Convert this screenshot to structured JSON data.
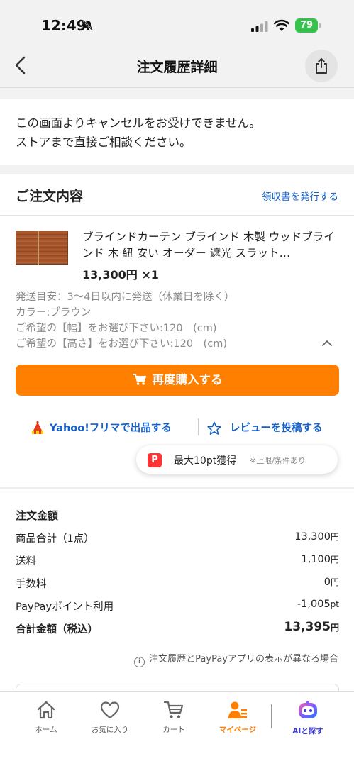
{
  "status": {
    "time": "12:49",
    "battery": "79"
  },
  "header": {
    "title": "注文履歴詳細"
  },
  "notice": {
    "line1": "この画面よりキャンセルをお受けできません。",
    "line2": "ストアまで直接ご相談ください。"
  },
  "order": {
    "section_title": "ご注文内容",
    "receipt_link": "領収書を発行する",
    "product": {
      "title": "ブラインドカーテン ブラインド 木製 ウッドブラインド 木 紐 安い オーダー 遮光 スラット…",
      "price": "13,300円 ×1",
      "shipping": "発送目安：3～4日以内に発送（休業日を除く）",
      "color": "カラー:ブラウン",
      "width": "ご希望の【幅】をお選び下さい:120　(cm)",
      "height": "ご希望の【高さ】をお選び下さい:120　(cm)"
    },
    "rebuy_button": "再度購入する",
    "flea_link": "Yahoo!フリマで出品する",
    "review_link": "レビューを投稿する",
    "points": {
      "text": "最大10pt獲得",
      "note": "※上限/条件あり"
    }
  },
  "summary": {
    "title": "注文金額",
    "rows": [
      {
        "label": "商品合計（1点）",
        "value": "13,300",
        "unit": "円"
      },
      {
        "label": "送料",
        "value": "1,100",
        "unit": "円"
      },
      {
        "label": "手数料",
        "value": "0",
        "unit": "円"
      },
      {
        "label": "PayPayポイント利用",
        "value": "-1,005",
        "unit": "pt"
      },
      {
        "label": "合計金額（税込）",
        "value": "13,395",
        "unit": "円"
      }
    ],
    "info_note": "注文履歴とPayPayアプリの表示が異なる場合"
  },
  "tabs": [
    {
      "label": "ホーム",
      "icon": "home-icon"
    },
    {
      "label": "お気に入り",
      "icon": "heart-icon"
    },
    {
      "label": "カート",
      "icon": "cart-icon"
    },
    {
      "label": "マイページ",
      "icon": "user-icon"
    },
    {
      "label": "AIと探す",
      "icon": "ai-robot-icon"
    }
  ],
  "colors": {
    "accent": "#ff7f00",
    "link": "#1560c8",
    "paypay": "#ff3333"
  }
}
